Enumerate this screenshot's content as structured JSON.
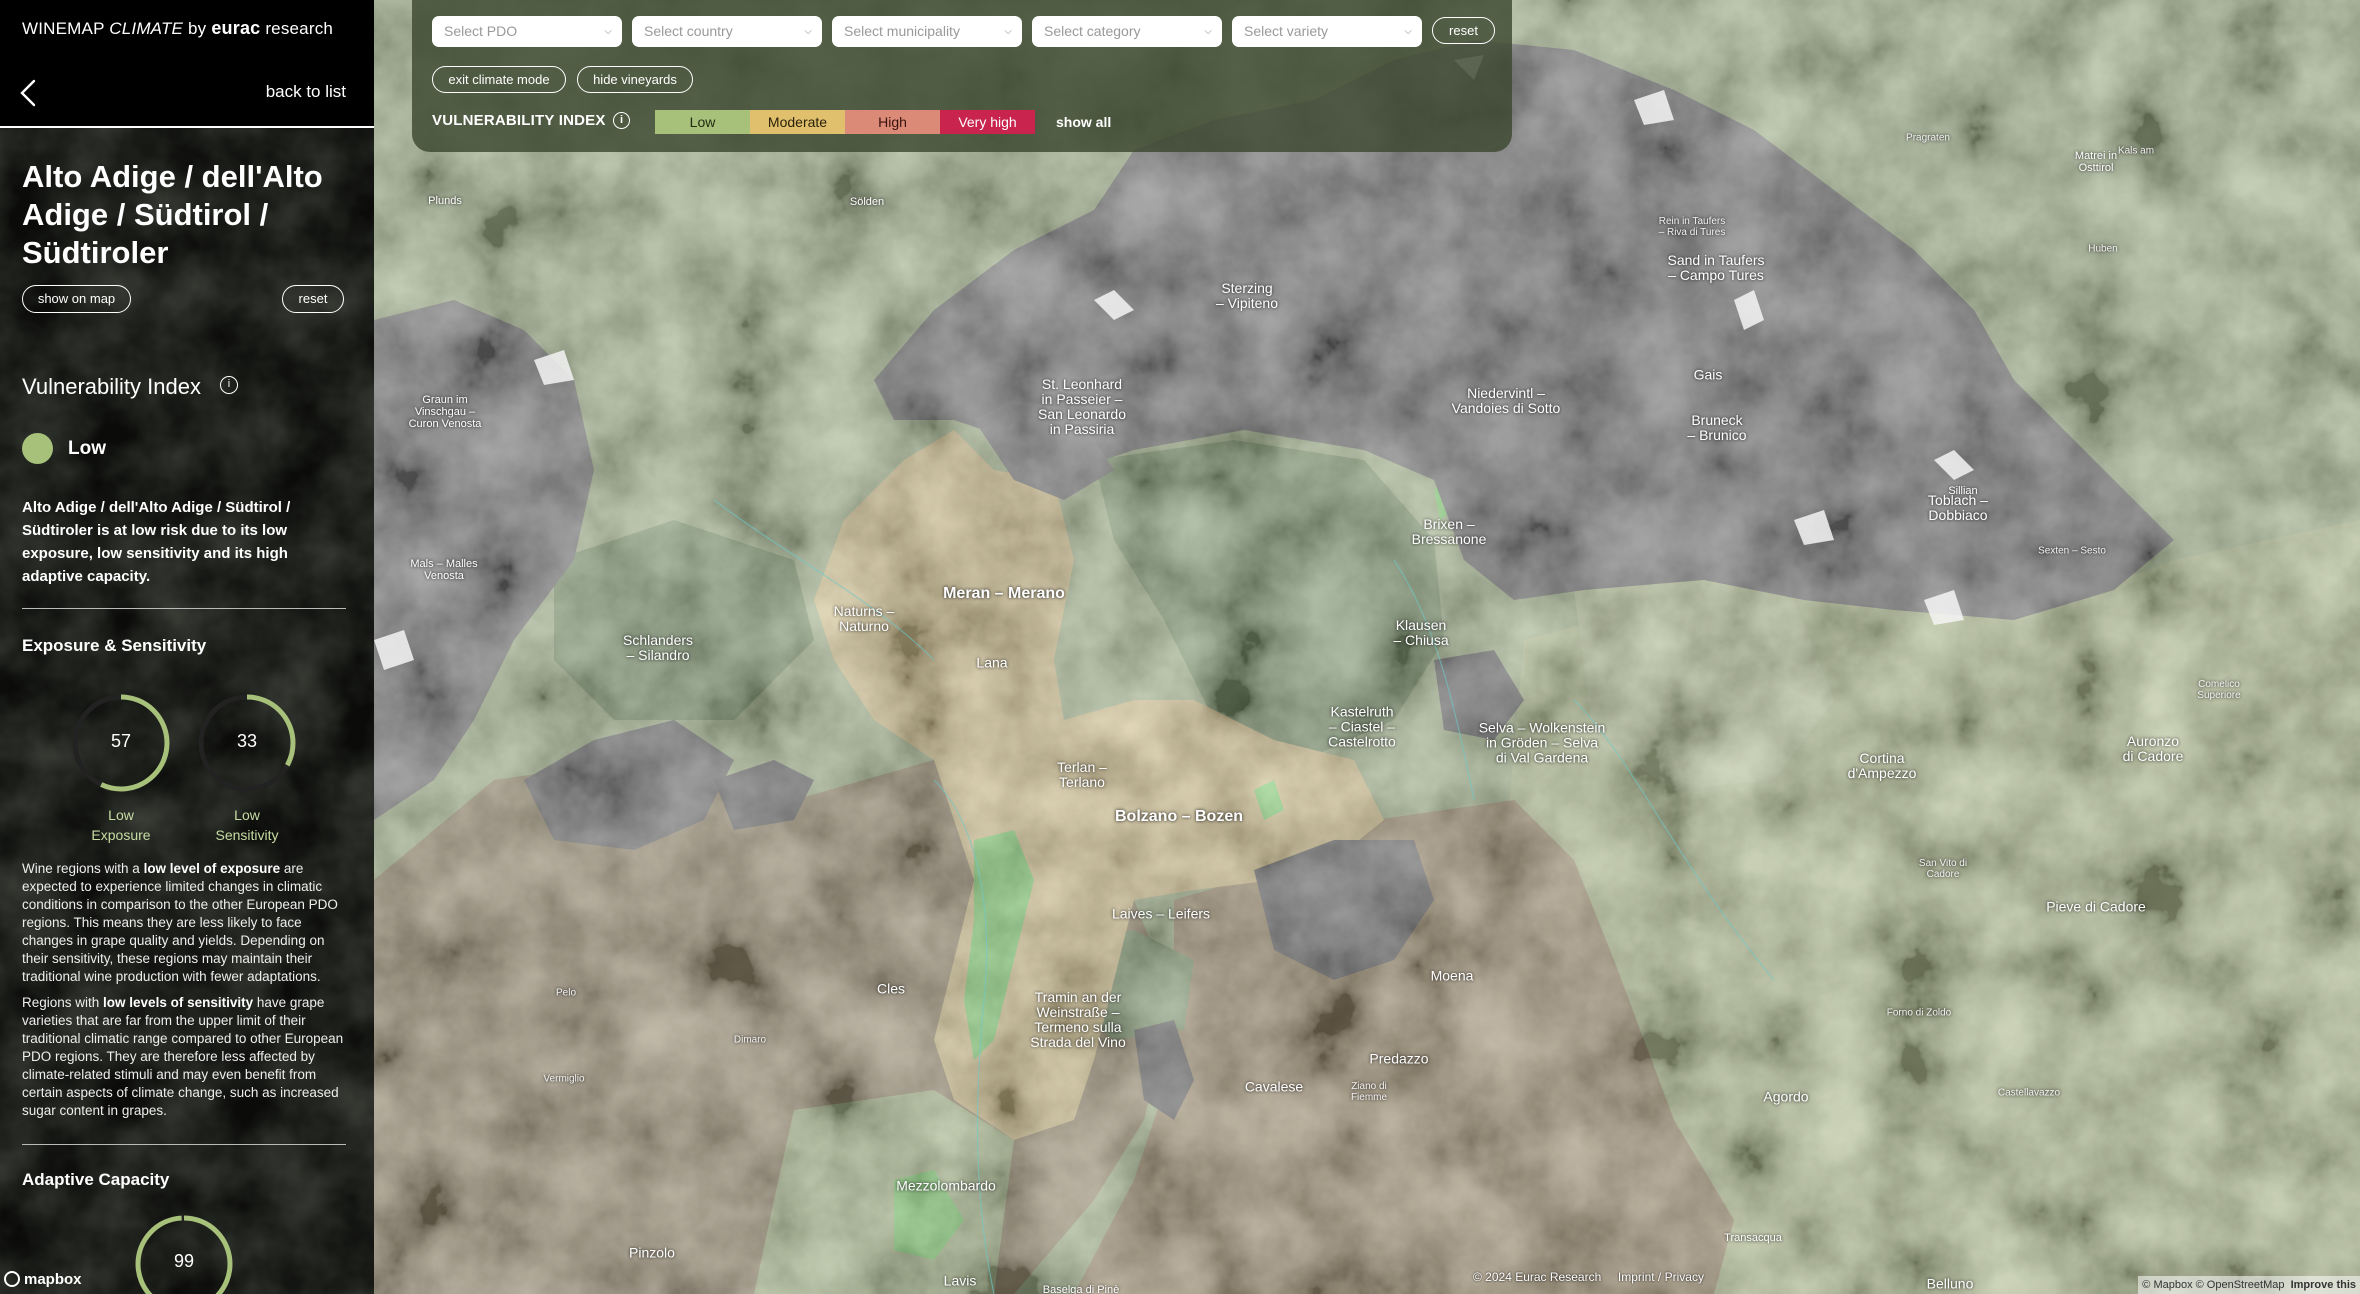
{
  "brand": {
    "name": "WINEMAP",
    "name_italic": "CLIMATE",
    "by": "by",
    "org_bold": "eurac",
    "org_rest": "research"
  },
  "nav": {
    "back_label": "back to list"
  },
  "region": {
    "title": "Alto Adige / dell'Alto Adige / Südtirol / Südtiroler",
    "show_on_map": "show on map",
    "reset": "reset"
  },
  "vulnerability": {
    "title": "Vulnerability Index",
    "level": "Low",
    "level_color": "#a7c17a",
    "summary": "Alto Adige / dell'Alto Adige / Südtirol / Südtiroler is at low risk due to its low exposure, low sensitivity and its high adaptive capacity."
  },
  "exposure_sensitivity": {
    "title": "Exposure & Sensitivity",
    "gauges": [
      {
        "value": "57",
        "fraction": 0.57,
        "caption_1": "Low",
        "caption_2": "Exposure"
      },
      {
        "value": "33",
        "fraction": 0.33,
        "caption_1": "Low",
        "caption_2": "Sensitivity"
      }
    ],
    "para1_pre": "Wine regions with a ",
    "para1_bold": "low level of exposure",
    "para1_post": " are expected to experience limited changes in climatic conditions in comparison to the other European PDO regions. This means they are less likely to face changes in grape quality and yields. Depending on their sensitivity, these regions may maintain their traditional wine production with fewer adaptations.",
    "para2_pre": "Regions with ",
    "para2_bold": "low levels of sensitivity",
    "para2_post": " have grape varieties that are far from the upper limit of their traditional climatic range compared to other European PDO regions. They are therefore less affected by climate-related stimuli and may even benefit from certain aspects of climate change, such as increased sugar content in grapes."
  },
  "adaptive_capacity": {
    "title": "Adaptive Capacity",
    "value": "99",
    "fraction": 0.99
  },
  "filters": {
    "selects": [
      {
        "placeholder": "Select PDO"
      },
      {
        "placeholder": "Select country"
      },
      {
        "placeholder": "Select municipality"
      },
      {
        "placeholder": "Select category"
      },
      {
        "placeholder": "Select variety"
      }
    ],
    "reset": "reset",
    "exit_climate_mode": "exit climate mode",
    "hide_vineyards": "hide vineyards",
    "vi_label": "VULNERABILITY INDEX",
    "legend": [
      {
        "label": "Low",
        "color": "#a7c17a",
        "text": "#1f2a10"
      },
      {
        "label": "Moderate",
        "color": "#e0c06c",
        "text": "#2a200a"
      },
      {
        "label": "High",
        "color": "#db8a78",
        "text": "#3a120c"
      },
      {
        "label": "Very high",
        "color": "#c8244e",
        "text": "#ffffff"
      }
    ],
    "show_all": "show all"
  },
  "places": [
    {
      "name": "Plunds",
      "size": "small"
    },
    {
      "name": "Sölden",
      "size": "small"
    },
    {
      "name": "Sterzing\n– Vipiteno",
      "size": "med"
    },
    {
      "name": "Rein in Taufers\n– Riva di Tures",
      "size": "tiny"
    },
    {
      "name": "Sand in Taufers\n– Campo Tures",
      "size": "med"
    },
    {
      "name": "Pragraten",
      "size": "tiny"
    },
    {
      "name": "Matrei in\nOsttirol",
      "size": "small"
    },
    {
      "name": "Kals am",
      "size": "tiny"
    },
    {
      "name": "Huben",
      "size": "tiny"
    },
    {
      "name": "Graun im\nVinschgau –\nCuron Venosta",
      "size": "small"
    },
    {
      "name": "St. Leonhard\nin Passeier –\nSan Leonardo\nin Passiria",
      "size": "med"
    },
    {
      "name": "Niedervintl –\nVandoies di Sotto",
      "size": "med"
    },
    {
      "name": "Gais",
      "size": "med"
    },
    {
      "name": "Bruneck\n– Brunico",
      "size": "med"
    },
    {
      "name": "Toblach –\nDobbiaco",
      "size": "med"
    },
    {
      "name": "Sillian",
      "size": "small"
    },
    {
      "name": "Sexten – Sesto",
      "size": "tiny"
    },
    {
      "name": "Mals – Malles\nVenosta",
      "size": "small"
    },
    {
      "name": "Brixen –\nBressanone",
      "size": "med"
    },
    {
      "name": "Meran – Merano",
      "size": "big"
    },
    {
      "name": "Naturns –\nNaturno",
      "size": "med"
    },
    {
      "name": "Schlanders\n– Silandro",
      "size": "med"
    },
    {
      "name": "Klausen\n– Chiusa",
      "size": "med"
    },
    {
      "name": "Lana",
      "size": "med"
    },
    {
      "name": "Kastelruth\n– Ciastel –\nCastelrotto",
      "size": "med"
    },
    {
      "name": "Selva – Wolkenstein\nin Gröden – Selva\ndi Val Gardena",
      "size": "med"
    },
    {
      "name": "Comelico\nSuperiore",
      "size": "tiny"
    },
    {
      "name": "Cortina\nd'Ampezzo",
      "size": "med"
    },
    {
      "name": "Auronzo\ndi Cadore",
      "size": "med"
    },
    {
      "name": "Terlan –\nTerlano",
      "size": "med"
    },
    {
      "name": "Bolzano – Bozen",
      "size": "big"
    },
    {
      "name": "San Vito di\nCadore",
      "size": "tiny"
    },
    {
      "name": "Pieve di Cadore",
      "size": "med"
    },
    {
      "name": "Laives – Leifers",
      "size": "med"
    },
    {
      "name": "Moena",
      "size": "med"
    },
    {
      "name": "Pelo",
      "size": "tiny"
    },
    {
      "name": "Cles",
      "size": "med"
    },
    {
      "name": "Dimaro",
      "size": "tiny"
    },
    {
      "name": "Tramin an der\nWeinstraße –\nTermeno sulla\nStrada del Vino",
      "size": "med"
    },
    {
      "name": "Forno di Zoldo",
      "size": "tiny"
    },
    {
      "name": "Vermiglio",
      "size": "tiny"
    },
    {
      "name": "Predazzo",
      "size": "med"
    },
    {
      "name": "Cavalese",
      "size": "med"
    },
    {
      "name": "Ziano di\nFiemme",
      "size": "tiny"
    },
    {
      "name": "Agordo",
      "size": "med"
    },
    {
      "name": "Castellavazzo",
      "size": "tiny"
    },
    {
      "name": "Mezzolombardo",
      "size": "med"
    },
    {
      "name": "Transacqua",
      "size": "small"
    },
    {
      "name": "Pinzolo",
      "size": "med"
    },
    {
      "name": "Lavis",
      "size": "med"
    },
    {
      "name": "Baselga di Pinè",
      "size": "small"
    },
    {
      "name": "Belluno",
      "size": "med"
    }
  ],
  "footer": {
    "mapbox": "mapbox",
    "copyright": "© 2024 Eurac Research",
    "imprint": "Imprint / Privacy",
    "attribution": "© Mapbox © OpenStreetMap",
    "improve": "Improve this"
  }
}
